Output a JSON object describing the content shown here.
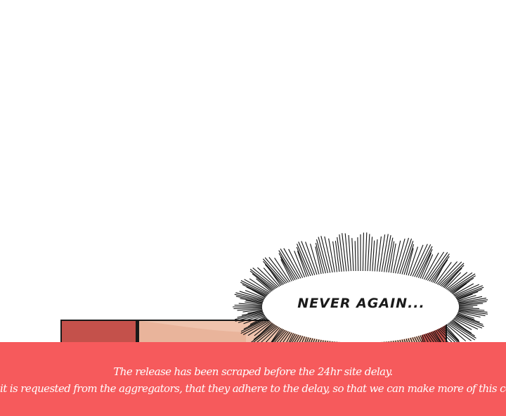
{
  "speech_bubble": {
    "text": "NEVER AGAIN..."
  },
  "notice": {
    "line1": "The release has been scraped before the 24hr site delay.",
    "line2": "it is requested from the aggregators, that they adhere to the delay, so that we can make more of this content",
    "background_color": "#f65a5c",
    "text_color": "#ffffff"
  }
}
